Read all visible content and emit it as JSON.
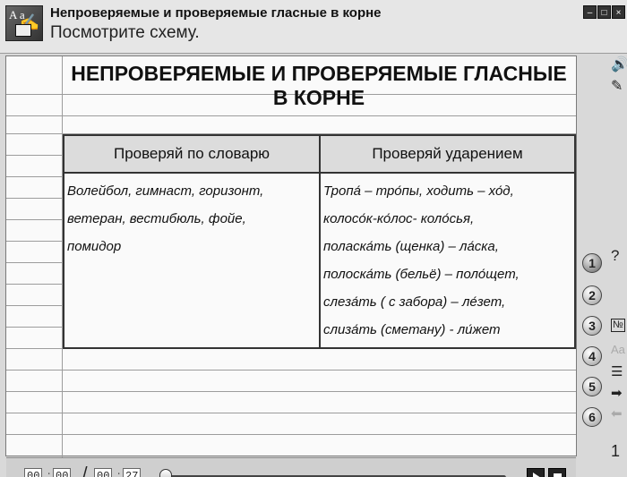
{
  "window": {
    "title": "Непроверяемые и проверяемые  гласные в корне",
    "subtitle": "Посмотрите схему.",
    "controls": [
      "–",
      "□",
      "×"
    ]
  },
  "heading": {
    "line1": "НЕПРОВЕРЯЕМЫЕ И ПРОВЕРЯЕМЫЕ ГЛАСНЫЕ",
    "line2": "В КОРНЕ"
  },
  "table": {
    "headers": [
      "Проверяй по словарю",
      "Проверяй ударением"
    ],
    "left_lines": [
      "Волейбол, гимнаст, горизонт,",
      "ветеран, вестибюль, фойе,",
      "помидор"
    ],
    "right_lines": [
      "Тропа́ – тро́пы, ходить – хо́д,",
      "колосо́к-ко́лос- коло́сья,",
      "поласка́ть (щенка) – ла́ска,",
      "полоска́ть (бельё) – поло́щет,",
      "слеза́ть ( с забора) – ле́зет,",
      "слиза́ть (сметану) - ли́жет"
    ]
  },
  "player": {
    "current_min": "00",
    "current_sec": "00",
    "total_min": "00",
    "total_sec": "27",
    "progress": 0
  },
  "sidebar": {
    "steps": [
      "1",
      "2",
      "3",
      "4",
      "5",
      "6"
    ],
    "active_step": "1",
    "icons": [
      "sound-icon",
      "pencil-icon",
      "help-icon",
      "number-icon",
      "font-icon",
      "list-icon",
      "next-arrow-icon",
      "prev-arrow-icon"
    ],
    "page_number": "1"
  }
}
